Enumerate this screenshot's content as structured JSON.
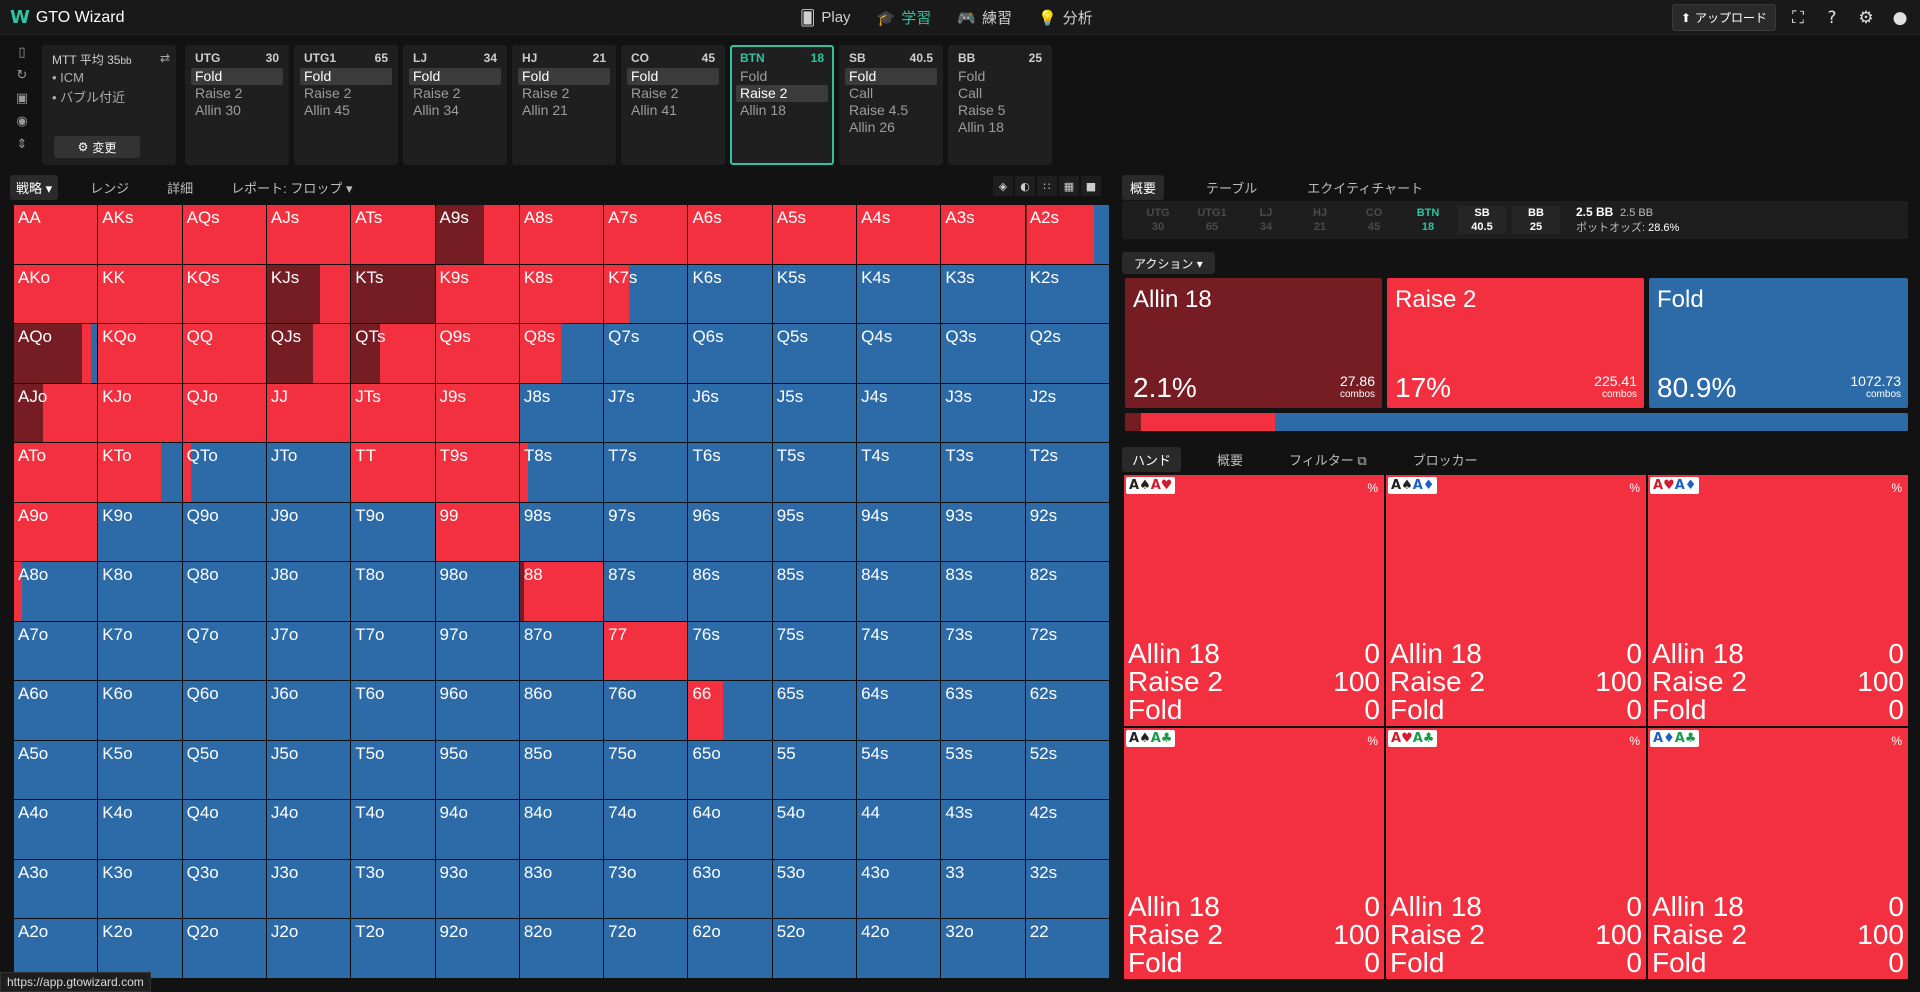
{
  "app": {
    "name": "GTO Wizard",
    "logo_mark": "W",
    "status_url": "https://app.gtowizard.com"
  },
  "nav": [
    {
      "icon": "cards-icon",
      "glyph": "🂠",
      "label": "Play",
      "active": false
    },
    {
      "icon": "graduation-cap-icon",
      "glyph": "🎓",
      "label": "学習",
      "active": true
    },
    {
      "icon": "gamepad-icon",
      "glyph": "🎮",
      "label": "練習",
      "active": false
    },
    {
      "icon": "lightbulb-icon",
      "glyph": "💡",
      "label": "分析",
      "active": false
    }
  ],
  "top_right": {
    "upload_label": "アップロード",
    "upload_glyph": "⬆"
  },
  "game": {
    "title": "MTT 平均 35",
    "title_unit": "bb",
    "bullets": [
      "• ICM",
      "• バブル付近"
    ],
    "change_label": "変更",
    "change_glyph": "⚙"
  },
  "positions": [
    {
      "name": "UTG",
      "stack": "30",
      "actions": [
        "Fold",
        "Raise 2",
        "Allin 30"
      ],
      "selected": 0,
      "active": false
    },
    {
      "name": "UTG1",
      "stack": "65",
      "actions": [
        "Fold",
        "Raise 2",
        "Allin 45"
      ],
      "selected": 0,
      "active": false
    },
    {
      "name": "LJ",
      "stack": "34",
      "actions": [
        "Fold",
        "Raise 2",
        "Allin 34"
      ],
      "selected": 0,
      "active": false
    },
    {
      "name": "HJ",
      "stack": "21",
      "actions": [
        "Fold",
        "Raise 2",
        "Allin 21"
      ],
      "selected": 0,
      "active": false
    },
    {
      "name": "CO",
      "stack": "45",
      "actions": [
        "Fold",
        "Raise 2",
        "Allin 41"
      ],
      "selected": 0,
      "active": false
    },
    {
      "name": "BTN",
      "stack": "18",
      "actions": [
        "Fold",
        "Raise 2",
        "Allin 18"
      ],
      "selected": 1,
      "active": true
    },
    {
      "name": "SB",
      "stack": "40.5",
      "actions": [
        "Fold",
        "Call",
        "Raise 4.5",
        "Allin 26"
      ],
      "selected": 0,
      "active": false
    },
    {
      "name": "BB",
      "stack": "25",
      "actions": [
        "Fold",
        "Call",
        "Raise 5",
        "Allin 18"
      ],
      "selected": -1,
      "active": false
    }
  ],
  "left_tabs": [
    {
      "label": "戦略 ▾",
      "active": true
    },
    {
      "label": "レンジ",
      "active": false
    },
    {
      "label": "詳細",
      "active": false
    },
    {
      "label": "レポート: フロップ ▾",
      "active": false
    }
  ],
  "colors": {
    "allin": "#761d24",
    "raise": "#f2303f",
    "fold": "#2d6ba8"
  },
  "hands": [
    [
      "AA",
      "AKs",
      "AQs",
      "AJs",
      "ATs",
      "A9s",
      "A8s",
      "A7s",
      "A6s",
      "A5s",
      "A4s",
      "A3s",
      "A2s"
    ],
    [
      "AKo",
      "KK",
      "KQs",
      "KJs",
      "KTs",
      "K9s",
      "K8s",
      "K7s",
      "K6s",
      "K5s",
      "K4s",
      "K3s",
      "K2s"
    ],
    [
      "AQo",
      "KQo",
      "QQ",
      "QJs",
      "QTs",
      "Q9s",
      "Q8s",
      "Q7s",
      "Q6s",
      "Q5s",
      "Q4s",
      "Q3s",
      "Q2s"
    ],
    [
      "AJo",
      "KJo",
      "QJo",
      "JJ",
      "JTs",
      "J9s",
      "J8s",
      "J7s",
      "J6s",
      "J5s",
      "J4s",
      "J3s",
      "J2s"
    ],
    [
      "ATo",
      "KTo",
      "QTo",
      "JTo",
      "TT",
      "T9s",
      "T8s",
      "T7s",
      "T6s",
      "T5s",
      "T4s",
      "T3s",
      "T2s"
    ],
    [
      "A9o",
      "K9o",
      "Q9o",
      "J9o",
      "T9o",
      "99",
      "98s",
      "97s",
      "96s",
      "95s",
      "94s",
      "93s",
      "92s"
    ],
    [
      "A8o",
      "K8o",
      "Q8o",
      "J8o",
      "T8o",
      "98o",
      "88",
      "87s",
      "86s",
      "85s",
      "84s",
      "83s",
      "82s"
    ],
    [
      "A7o",
      "K7o",
      "Q7o",
      "J7o",
      "T7o",
      "97o",
      "87o",
      "77",
      "76s",
      "75s",
      "74s",
      "73s",
      "72s"
    ],
    [
      "A6o",
      "K6o",
      "Q6o",
      "J6o",
      "T6o",
      "96o",
      "86o",
      "76o",
      "66",
      "65s",
      "64s",
      "63s",
      "62s"
    ],
    [
      "A5o",
      "K5o",
      "Q5o",
      "J5o",
      "T5o",
      "95o",
      "85o",
      "75o",
      "65o",
      "55",
      "54s",
      "53s",
      "52s"
    ],
    [
      "A4o",
      "K4o",
      "Q4o",
      "J4o",
      "T4o",
      "94o",
      "84o",
      "74o",
      "64o",
      "54o",
      "44",
      "43s",
      "42s"
    ],
    [
      "A3o",
      "K3o",
      "Q3o",
      "J3o",
      "T3o",
      "93o",
      "83o",
      "73o",
      "63o",
      "53o",
      "43o",
      "33",
      "32s"
    ],
    [
      "A2o",
      "K2o",
      "Q2o",
      "J2o",
      "T2o",
      "92o",
      "82o",
      "72o",
      "62o",
      "52o",
      "42o",
      "32o",
      "22"
    ]
  ],
  "strategy": {
    "A9s": [
      0.58,
      0.42
    ],
    "A2s": [
      0.02,
      0.8
    ],
    "KJs": [
      0.64,
      0.36
    ],
    "KTs": [
      1,
      0
    ],
    "K7s": [
      0,
      0.3
    ],
    "AQo": [
      0.82,
      0.1
    ],
    "QJs": [
      0.55,
      0.45
    ],
    "QTs": [
      0.35,
      0.65
    ],
    "Q8s": [
      0,
      0.5
    ],
    "AJo": [
      0.35,
      0.65
    ],
    "J9s": [
      0,
      1
    ],
    "KTo": [
      0,
      0.75
    ],
    "QTo": [
      0,
      0.1
    ],
    "T8s": [
      0,
      0.1
    ],
    "99": [
      0,
      1
    ],
    "A8o": [
      0,
      0.1
    ],
    "88": [
      0.05,
      0.95
    ],
    "66": [
      0,
      0.42
    ],
    "AJs": [
      0,
      1
    ],
    "ATs": [
      0,
      1
    ],
    "A8s": [
      0,
      1
    ],
    "A7s": [
      0,
      1
    ],
    "A6s": [
      0,
      1
    ],
    "A5s": [
      0,
      1
    ],
    "A4s": [
      0,
      1
    ],
    "A3s": [
      0,
      1
    ],
    "AA": [
      0,
      1
    ],
    "AKs": [
      0,
      1
    ],
    "AQs": [
      0,
      1
    ],
    "AKo": [
      0,
      1
    ],
    "KK": [
      0,
      1
    ],
    "KQs": [
      0,
      1
    ],
    "K9s": [
      0,
      1
    ],
    "K8s": [
      0,
      1
    ],
    "KQo": [
      0,
      1
    ],
    "QQ": [
      0,
      1
    ],
    "Q9s": [
      0,
      1
    ],
    "KJo": [
      0,
      1
    ],
    "QJo": [
      0,
      1
    ],
    "JJ": [
      0,
      1
    ],
    "JTs": [
      0,
      1
    ],
    "ATo": [
      0,
      1
    ],
    "TT": [
      0,
      1
    ],
    "T9s": [
      0,
      1
    ],
    "A9o": [
      0,
      1
    ],
    "77": [
      0,
      1
    ]
  },
  "right_tabs": [
    {
      "label": "概要",
      "active": true
    },
    {
      "label": "テーブル",
      "active": false
    },
    {
      "label": "エクイティチャート",
      "active": false
    }
  ],
  "strip": [
    {
      "name": "UTG",
      "stack": "30",
      "state": "folded"
    },
    {
      "name": "UTG1",
      "stack": "65",
      "state": "folded"
    },
    {
      "name": "LJ",
      "stack": "34",
      "state": "folded"
    },
    {
      "name": "HJ",
      "stack": "21",
      "state": "folded"
    },
    {
      "name": "CO",
      "stack": "45",
      "state": "folded"
    },
    {
      "name": "BTN",
      "stack": "18",
      "state": "current"
    },
    {
      "name": "SB",
      "stack": "40.5",
      "state": "pending"
    },
    {
      "name": "BB",
      "stack": "25",
      "state": "pending"
    }
  ],
  "pot": {
    "line1_bold": "2.5 BB",
    "line1": "2.5 BB",
    "odds_label": "ポットオッズ:",
    "odds": "28.6%"
  },
  "action_dropdown": "アクション ▾",
  "actions": [
    {
      "name": "Allin 18",
      "pct": "2.1%",
      "combos": "27.86",
      "combos_label": "combos",
      "color": "#761d24",
      "share": 0.021
    },
    {
      "name": "Raise 2",
      "pct": "17%",
      "combos": "225.41",
      "combos_label": "combos",
      "color": "#f2303f",
      "share": 0.17
    },
    {
      "name": "Fold",
      "pct": "80.9%",
      "combos": "1072.73",
      "combos_label": "combos",
      "color": "#2d6ba8",
      "share": 0.809
    }
  ],
  "hand_tabs": [
    {
      "label": "ハンド",
      "active": true
    },
    {
      "label": "概要",
      "active": false
    },
    {
      "label": "フィルター ⧉",
      "active": false
    },
    {
      "label": "ブロッカー",
      "active": false
    }
  ],
  "combos": [
    {
      "cards": [
        {
          "r": "A",
          "s": "♠",
          "c": "#222"
        },
        {
          "r": "A",
          "s": "♥",
          "c": "#d21b2c"
        }
      ],
      "pct": "%",
      "lines": [
        [
          "Allin 18",
          "0"
        ],
        [
          "Raise 2",
          "100"
        ],
        [
          "Fold",
          "0"
        ]
      ]
    },
    {
      "cards": [
        {
          "r": "A",
          "s": "♠",
          "c": "#222"
        },
        {
          "r": "A",
          "s": "♦",
          "c": "#1f5fc4"
        }
      ],
      "pct": "%",
      "lines": [
        [
          "Allin 18",
          "0"
        ],
        [
          "Raise 2",
          "100"
        ],
        [
          "Fold",
          "0"
        ]
      ]
    },
    {
      "cards": [
        {
          "r": "A",
          "s": "♥",
          "c": "#d21b2c"
        },
        {
          "r": "A",
          "s": "♦",
          "c": "#1f5fc4"
        }
      ],
      "pct": "%",
      "lines": [
        [
          "Allin 18",
          "0"
        ],
        [
          "Raise 2",
          "100"
        ],
        [
          "Fold",
          "0"
        ]
      ]
    },
    {
      "cards": [
        {
          "r": "A",
          "s": "♠",
          "c": "#222"
        },
        {
          "r": "A",
          "s": "♣",
          "c": "#1c9a4a"
        }
      ],
      "pct": "%",
      "lines": [
        [
          "Allin 18",
          "0"
        ],
        [
          "Raise 2",
          "100"
        ],
        [
          "Fold",
          "0"
        ]
      ]
    },
    {
      "cards": [
        {
          "r": "A",
          "s": "♥",
          "c": "#d21b2c"
        },
        {
          "r": "A",
          "s": "♣",
          "c": "#1c9a4a"
        }
      ],
      "pct": "%",
      "lines": [
        [
          "Allin 18",
          "0"
        ],
        [
          "Raise 2",
          "100"
        ],
        [
          "Fold",
          "0"
        ]
      ]
    },
    {
      "cards": [
        {
          "r": "A",
          "s": "♦",
          "c": "#1f5fc4"
        },
        {
          "r": "A",
          "s": "♣",
          "c": "#1c9a4a"
        }
      ],
      "pct": "%",
      "lines": [
        [
          "Allin 18",
          "0"
        ],
        [
          "Raise 2",
          "100"
        ],
        [
          "Fold",
          "0"
        ]
      ]
    }
  ]
}
